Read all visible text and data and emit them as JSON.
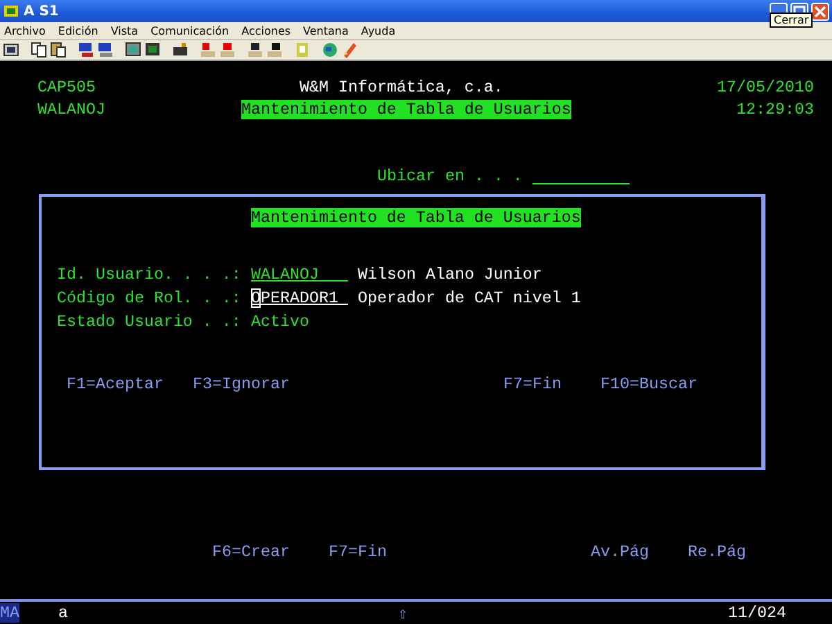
{
  "window": {
    "title": "A S1",
    "tooltip": "Cerrar"
  },
  "menu": [
    "Archivo",
    "Edición",
    "Vista",
    "Comunicación",
    "Acciones",
    "Ventana",
    "Ayuda"
  ],
  "screen": {
    "program": "CAP505",
    "user": "WALANOJ",
    "company": "W&M Informática, c.a.",
    "title": "Mantenimiento de Tabla de Usuarios",
    "date": "17/05/2010",
    "time": "12:29:03",
    "locate_label": "Ubicar en . . .",
    "popup": {
      "title": "Mantenimiento de Tabla de Usuarios",
      "fields": [
        {
          "label": "Id. Usuario. . . .:",
          "value": "WALANOJ",
          "kind": "input",
          "focused": false,
          "description": "Wilson Alano Junior"
        },
        {
          "label": "Código de Rol. . .:",
          "value": "OPERADOR1",
          "kind": "input",
          "focused": true,
          "description": "Operador de CAT nivel 1"
        },
        {
          "label": "Estado Usuario . .:",
          "value": "Activo",
          "kind": "output",
          "focused": false
        }
      ],
      "function_keys": [
        "F1=Aceptar",
        "F3=Ignorar",
        "F7=Fin",
        "F10=Buscar"
      ]
    },
    "function_keys": [
      "F6=Crear",
      "F7=Fin",
      "Av.Pág",
      "Re.Pág"
    ]
  },
  "status": {
    "mode": "MA",
    "input": "a",
    "shift": "⇧",
    "position": "11/024"
  }
}
